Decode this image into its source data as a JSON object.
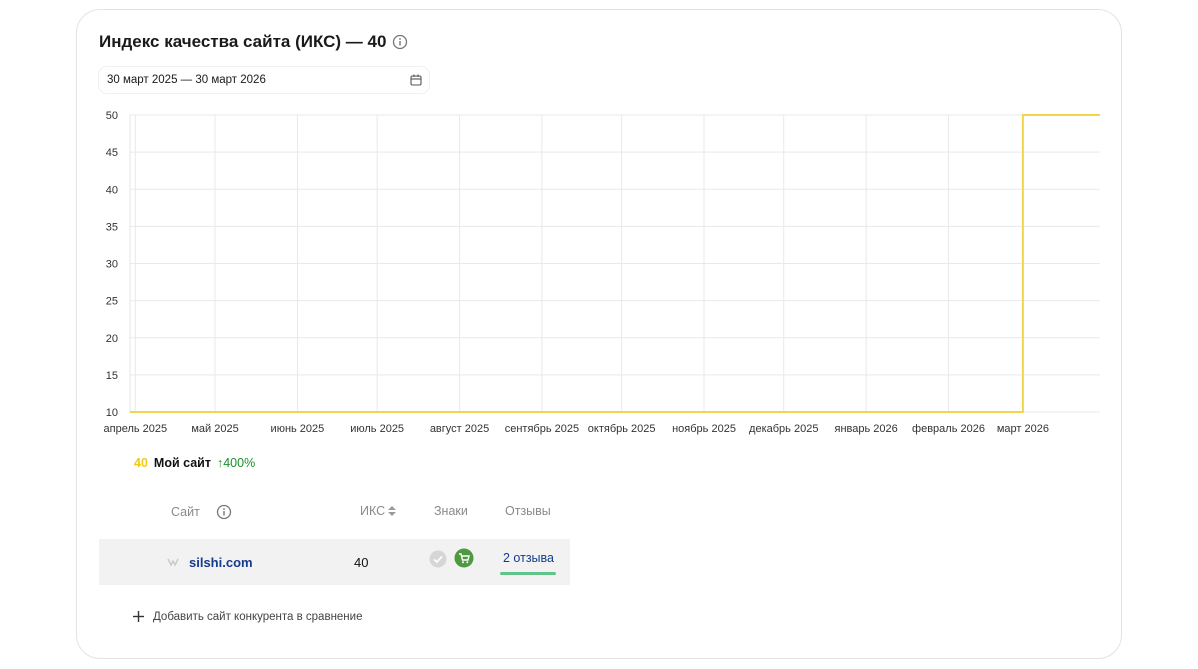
{
  "header": {
    "title": "Индекс качества сайта (ИКС) — 40"
  },
  "date_range": {
    "value": "30 март 2025 — 30 март 2026"
  },
  "chart_data": {
    "type": "line",
    "title": "",
    "xlabel": "",
    "ylabel": "",
    "x": [
      "2025-03-30",
      "2026-03-01",
      "2026-03-01",
      "2026-03-30"
    ],
    "series": [
      {
        "name": "Мой сайт",
        "color": "#f3d54d",
        "values": [
          10,
          10,
          50,
          50
        ]
      }
    ],
    "x_ticks": [
      {
        "label": "апрель 2025",
        "date": "2025-04-01"
      },
      {
        "label": "май 2025",
        "date": "2025-05-01"
      },
      {
        "label": "июнь 2025",
        "date": "2025-06-01"
      },
      {
        "label": "июль 2025",
        "date": "2025-07-01"
      },
      {
        "label": "август 2025",
        "date": "2025-08-01"
      },
      {
        "label": "сентябрь 2025",
        "date": "2025-09-01"
      },
      {
        "label": "октябрь 2025",
        "date": "2025-10-01"
      },
      {
        "label": "ноябрь 2025",
        "date": "2025-11-01"
      },
      {
        "label": "декабрь 2025",
        "date": "2025-12-01"
      },
      {
        "label": "январь 2026",
        "date": "2026-01-01"
      },
      {
        "label": "февраль 2026",
        "date": "2026-02-01"
      },
      {
        "label": "март 2026",
        "date": "2026-03-01"
      }
    ],
    "xlim": [
      "2025-03-30",
      "2026-03-30"
    ],
    "y_ticks": [
      10,
      15,
      20,
      25,
      30,
      35,
      40,
      45,
      50
    ],
    "ylim": [
      10,
      50
    ],
    "grid": true,
    "legend_placement": "bottom-left"
  },
  "legend": {
    "value": "40",
    "name": "Мой сайт",
    "delta": "↑400%"
  },
  "table": {
    "headers": {
      "site": "Сайт",
      "iks": "ИКС",
      "badges": "Знаки",
      "reviews": "Отзывы"
    },
    "rows": [
      {
        "site": "silshi.com",
        "iks": "40",
        "reviews": "2 отзыва"
      }
    ]
  },
  "add_competitor": {
    "label": "Добавить сайт конкурента в сравнение"
  },
  "colors": {
    "accent_line": "#f3d54d",
    "link": "#153b8c",
    "positive": "#1a8f2b",
    "badge_green": "#4f9a3e"
  }
}
